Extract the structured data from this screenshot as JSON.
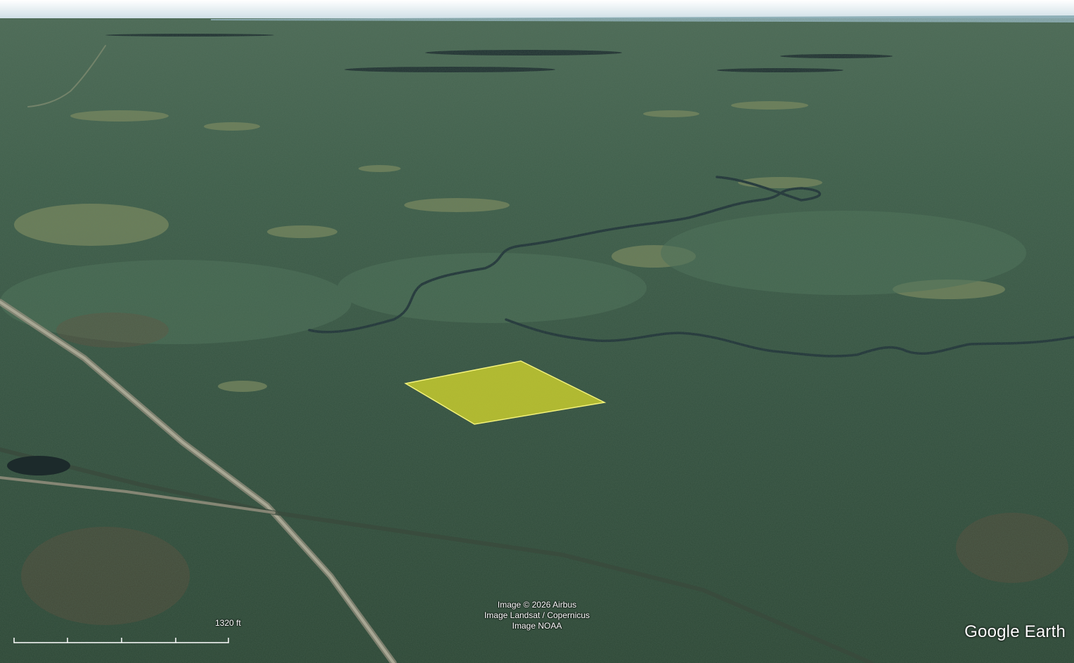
{
  "attribution": {
    "line1": "Image © 2026 Airbus",
    "line2": "Image Landsat / Copernicus",
    "line3": "Image NOAA"
  },
  "scale_bar": {
    "label": "1320 ft"
  },
  "logo": {
    "text": "Google Earth"
  },
  "colors": {
    "sky": "#dde8ec",
    "forest": "#2f4a3a",
    "river": "#1d3036",
    "wetland": "#7f8a5c",
    "parcel_fill": "#e3e22a",
    "parcel_stroke": "#f4f27a",
    "road": "#9b9a88"
  }
}
